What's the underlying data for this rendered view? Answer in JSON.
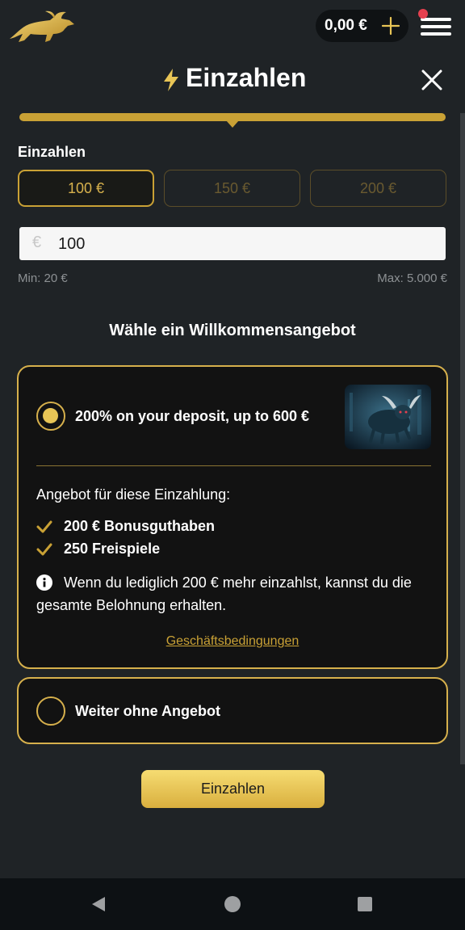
{
  "header": {
    "balance": "0,00 €",
    "icons": {
      "logo": "bull-logo-icon",
      "add": "plus-icon",
      "menu": "hamburger-menu-icon",
      "notification": "notification-dot"
    }
  },
  "modal": {
    "title": "Einzahlen",
    "progress": 0.5,
    "deposit_label": "Einzahlen",
    "amount_options": [
      "100 €",
      "150 €",
      "200 €"
    ],
    "selected_amount_index": 0,
    "currency_symbol": "€",
    "amount_value": "100",
    "min_label": "Min: 20 €",
    "max_label": "Max: 5.000 €",
    "offer_heading": "Wähle ein Willkommensangebot",
    "offer": {
      "title": "200% on your deposit, up to 600 €",
      "selected": true,
      "subtitle": "Angebot für diese Einzahlung:",
      "bullets": [
        "200 € Bonusguthaben",
        "250 Freispiele"
      ],
      "info": "Wenn du lediglich 200 € mehr einzahlst, kannst du die gesamte Belohnung erhalten.",
      "terms_link": "Geschäftsbedingungen"
    },
    "no_offer_label": "Weiter ohne Angebot",
    "submit_label": "Einzahlen"
  },
  "colors": {
    "accent": "#c9a135",
    "background": "#1f2326",
    "card": "#121212"
  }
}
